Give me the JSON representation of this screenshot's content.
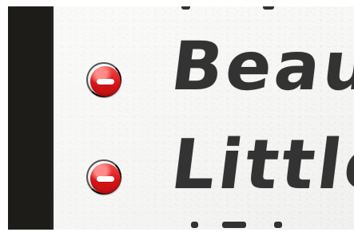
{
  "items": [
    {
      "label": "Beau",
      "delete_icon": "minus-circle-icon"
    },
    {
      "label": "Little",
      "delete_icon": "minus-circle-icon"
    }
  ],
  "colors": {
    "sidebar": "#1e1c19",
    "paper": "#f4f4f2",
    "ink": "#333333",
    "delete_red": "#d81518"
  }
}
